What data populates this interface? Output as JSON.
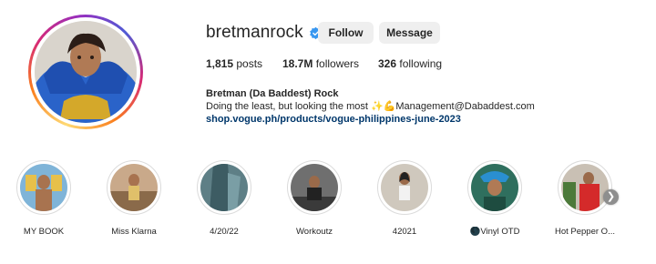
{
  "profile": {
    "username": "bretmanrock",
    "verified": true,
    "verified_icon": "verified-badge-icon",
    "follow_label": "Follow",
    "message_label": "Message"
  },
  "stats": {
    "posts_count": "1,815",
    "posts_label": "posts",
    "followers_count": "18.7M",
    "followers_label": "followers",
    "following_count": "326",
    "following_label": "following"
  },
  "bio": {
    "name": "Bretman (Da Baddest) Rock",
    "text": "Doing the least, but looking the most ✨💪Management@Dabaddest.com",
    "link": "shop.vogue.ph/products/vogue-philippines-june-2023"
  },
  "highlights": [
    {
      "label": "MY BOOK"
    },
    {
      "label": "Miss Klarna"
    },
    {
      "label": "4/20/22"
    },
    {
      "label": "Workoutz"
    },
    {
      "label": "42021"
    },
    {
      "label": "🌑Vinyl OTD"
    },
    {
      "label": "Hot Pepper O..."
    }
  ],
  "colors": {
    "link": "#00376b",
    "verified": "#3897f0",
    "button_bg": "#efefef"
  }
}
